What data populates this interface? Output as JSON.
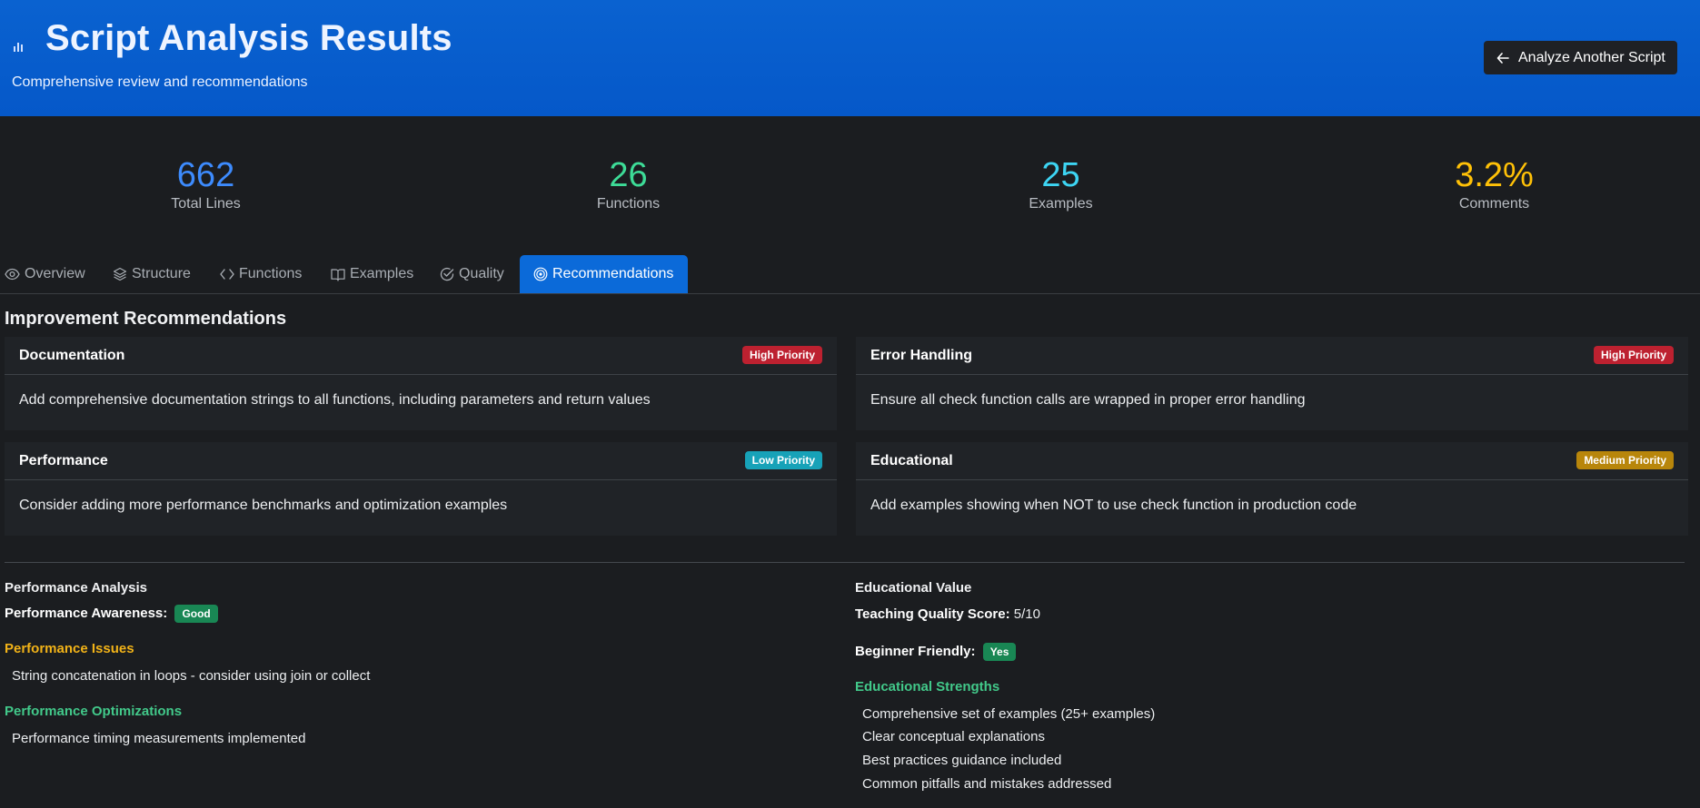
{
  "header": {
    "title": "Script Analysis Results",
    "subtitle": "Comprehensive review and recommendations",
    "back_button": "Analyze Another Script",
    "logo_icon": "bar-chart-icon"
  },
  "stats": [
    {
      "value": "662",
      "label": "Total Lines",
      "color": "#3d8bfd"
    },
    {
      "value": "26",
      "label": "Functions",
      "color": "#3ddc97"
    },
    {
      "value": "25",
      "label": "Examples",
      "color": "#3dd5f3"
    },
    {
      "value": "3.2%",
      "label": "Comments",
      "color": "#ffc107"
    }
  ],
  "tabs": [
    {
      "label": "Overview",
      "icon": "eye-icon"
    },
    {
      "label": "Structure",
      "icon": "layers-icon"
    },
    {
      "label": "Functions",
      "icon": "code-icon"
    },
    {
      "label": "Examples",
      "icon": "book-icon"
    },
    {
      "label": "Quality",
      "icon": "check-circle-icon"
    },
    {
      "label": "Recommendations",
      "icon": "target-icon",
      "active": true
    }
  ],
  "recommendations": {
    "title": "Improvement Recommendations",
    "items": [
      {
        "category": "Documentation",
        "priority": "High Priority",
        "text": "Add comprehensive documentation strings to all functions, including parameters and return values"
      },
      {
        "category": "Error Handling",
        "priority": "High Priority",
        "text": "Ensure all check function calls are wrapped in proper error handling"
      },
      {
        "category": "Performance",
        "priority": "Low Priority",
        "text": "Consider adding more performance benchmarks and optimization examples"
      },
      {
        "category": "Educational",
        "priority": "Medium Priority",
        "text": "Add examples showing when NOT to use check function in production code"
      }
    ]
  },
  "performance": {
    "title": "Performance Analysis",
    "awareness_label": "Performance Awareness:",
    "awareness_value": "Good",
    "issues_title": "Performance Issues",
    "issues": [
      "String concatenation in loops - consider using join or collect"
    ],
    "optimizations_title": "Performance Optimizations",
    "optimizations": [
      "Performance timing measurements implemented"
    ]
  },
  "educational": {
    "title": "Educational Value",
    "score_label": "Teaching Quality Score:",
    "score_value": "5/10",
    "beginner_label": "Beginner Friendly:",
    "beginner_value": "Yes",
    "strengths_title": "Educational Strengths",
    "strengths": [
      "Comprehensive set of examples (25+ examples)",
      "Clear conceptual explanations",
      "Best practices guidance included",
      "Common pitfalls and mistakes addressed"
    ]
  }
}
